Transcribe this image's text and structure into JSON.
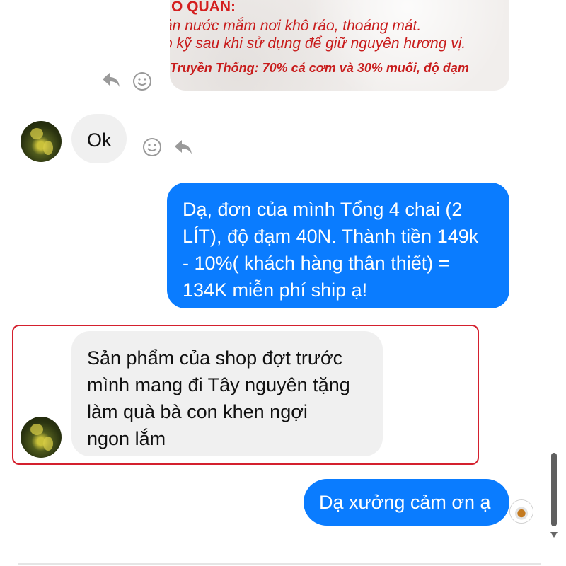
{
  "image_message": {
    "line1": "Ô QUẢN:",
    "line2": "ản nước mắm nơi khô ráo, thoáng mát.",
    "line3": "p kỹ sau khi sử dụng để giữ nguyên hương vị.",
    "line4": "Truyền Thống: 70% cá cơm và 30% muối, độ đạm"
  },
  "messages": [
    {
      "id": "m1",
      "direction": "incoming",
      "text": "Ok"
    },
    {
      "id": "m2",
      "direction": "outgoing",
      "lines": [
        "Dạ, đơn của mình Tổng 4 chai (2",
        "LÍT), độ đạm 40N. Thành tiền 149k",
        "- 10%( khách hàng thân thiết) =",
        "134K miễn phí ship ạ!"
      ]
    },
    {
      "id": "m3",
      "direction": "incoming",
      "highlighted": true,
      "lines": [
        "Sản phẩm của shop đợt trước",
        "mình mang đi Tây nguyên tặng",
        "làm quà bà con khen ngợi",
        "ngon lắm"
      ]
    },
    {
      "id": "m4",
      "direction": "outgoing",
      "text": "Dạ xưởng cảm ơn ạ"
    }
  ],
  "icons": {
    "reply": "reply-arrow-icon",
    "react": "smiley-icon"
  },
  "colors": {
    "outgoing_bubble": "#0a7cff",
    "incoming_bubble": "#f0f0f0",
    "highlight_border": "#d4202e"
  }
}
